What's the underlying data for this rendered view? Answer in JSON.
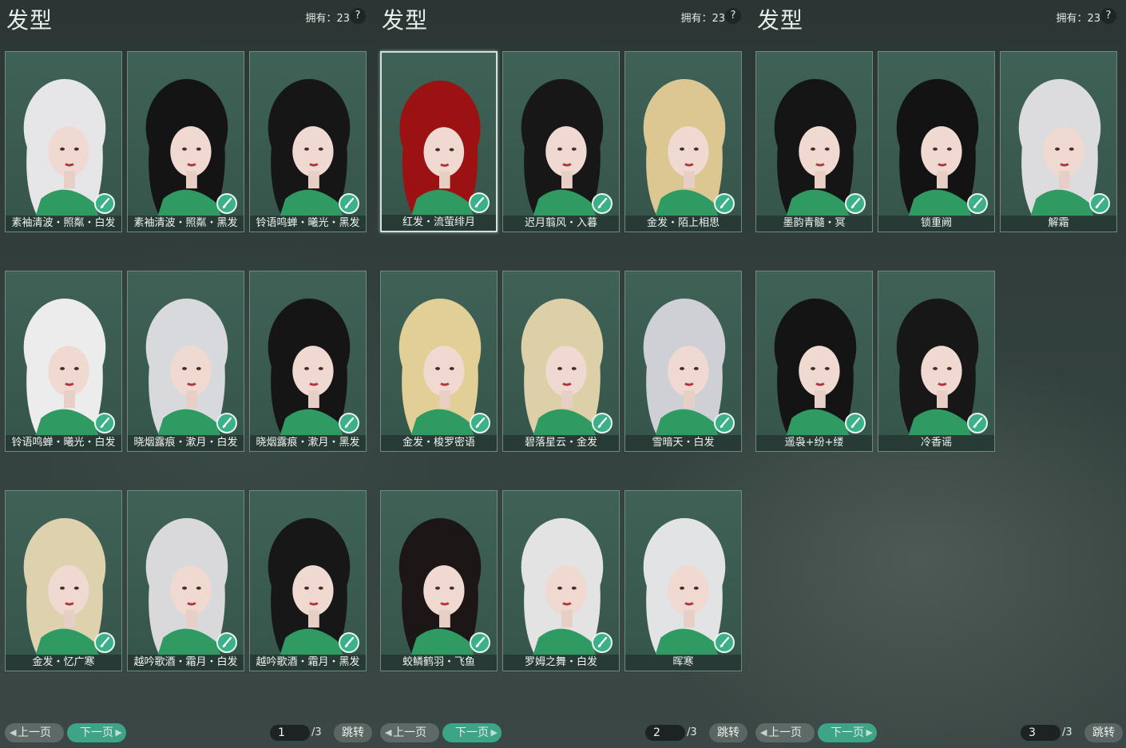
{
  "panels": [
    {
      "title": "发型",
      "owned": "拥有：23",
      "help": "?",
      "page": "1",
      "total": "/3",
      "prev_label": "上一页",
      "next_label": "下一页",
      "jump_label": "跳转",
      "cards": [
        {
          "label": "素袖清波・照粼・白发",
          "hair": "#e6e6e8"
        },
        {
          "label": "素袖清波・照粼・黑发",
          "hair": "#141414"
        },
        {
          "label": "铃语鸣蝉・曦光・黑发",
          "hair": "#161616"
        },
        {
          "label": "铃语鸣蝉・曦光・白发",
          "hair": "#ececec"
        },
        {
          "label": "晓烟露痕・漱月・白发",
          "hair": "#d8d9dc"
        },
        {
          "label": "晓烟露痕・漱月・黑发",
          "hair": "#151515"
        },
        {
          "label": "金发・忆广寒",
          "hair": "#ddd1ae"
        },
        {
          "label": "越吟歌酒・霜月・白发",
          "hair": "#d9d9dc"
        },
        {
          "label": "越吟歌酒・霜月・黑发",
          "hair": "#171717"
        }
      ]
    },
    {
      "title": "发型",
      "owned": "拥有：23",
      "help": "?",
      "page": "2",
      "total": "/3",
      "prev_label": "上一页",
      "next_label": "下一页",
      "jump_label": "跳转",
      "cards": [
        {
          "label": "红发・流萤绯月",
          "hair": "#9c1111",
          "selected": true
        },
        {
          "label": "迟月翦风・入暮",
          "hair": "#171717"
        },
        {
          "label": "金发・陌上相思",
          "hair": "#dcc692"
        },
        {
          "label": "金发・梭罗密语",
          "hair": "#e1cf96"
        },
        {
          "label": "碧落星云・金发",
          "hair": "#ddd0a8"
        },
        {
          "label": "雪暗天・白发",
          "hair": "#cfd0d6"
        },
        {
          "label": "蛟鳞鹤羽・飞鱼",
          "hair": "#1d1616"
        },
        {
          "label": "罗姆之舞・白发",
          "hair": "#e3e3e3"
        },
        {
          "label": "晖寒",
          "hair": "#e2e3e5"
        }
      ]
    },
    {
      "title": "发型",
      "owned": "拥有：23",
      "help": "?",
      "page": "3",
      "total": "/3",
      "prev_label": "上一页",
      "next_label": "下一页",
      "jump_label": "跳转",
      "cards": [
        {
          "label": "墨韵青髓・冥",
          "hair": "#151515"
        },
        {
          "label": "锁重阙",
          "hair": "#131313"
        },
        {
          "label": "解霜",
          "hair": "#dcdcdf"
        },
        {
          "label": "遥袅+纷+缕",
          "hair": "#141414"
        },
        {
          "label": "冷香谣",
          "hair": "#171717"
        }
      ]
    }
  ],
  "colors": {
    "card_bg": "#3f6156",
    "brush_button": "#3cb088",
    "next_button": "#3ea488",
    "prev_button": "#5d6a67"
  },
  "icons": {
    "brush": "brush-icon",
    "help": "help-icon",
    "prev_arrow": "chevron-left-icon",
    "next_arrow": "chevron-right-icon"
  }
}
